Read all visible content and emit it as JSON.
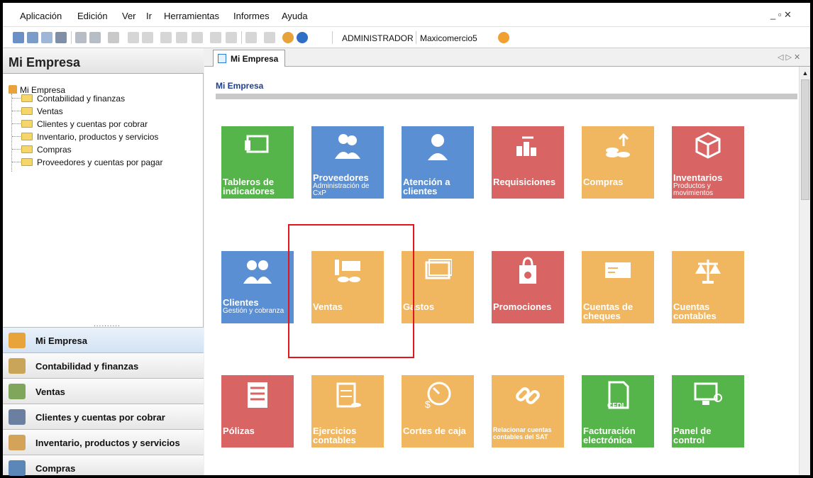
{
  "menubar": {
    "items": [
      "Aplicación",
      "Edición",
      "Ver",
      "Ir",
      "Herramientas",
      "Informes",
      "Ayuda"
    ],
    "window_controls": "_ ▫ ✕"
  },
  "toolbar": {
    "user": "ADMINISTRADOR",
    "company": "Maxicomercio5"
  },
  "left_panel": {
    "title": "Mi Empresa",
    "tree_root": "Mi Empresa",
    "tree_children": [
      "Contabilidad y finanzas",
      "Ventas",
      "Clientes y cuentas por cobrar",
      "Inventario, productos y servicios",
      "Compras",
      "Proveedores y cuentas por pagar"
    ],
    "dots": "..........",
    "nav": [
      "Mi Empresa",
      "Contabilidad y finanzas",
      "Ventas",
      "Clientes y cuentas por cobrar",
      "Inventario, productos y servicios",
      "Compras"
    ]
  },
  "tab": {
    "label": "Mi Empresa",
    "nav_controls": "◁ ▷ ✕"
  },
  "content": {
    "section_title": "Mi Empresa",
    "tiles": [
      {
        "title": "Tableros de indicadores",
        "subtitle": "",
        "color": "#55b44a",
        "icon": "dashboard-icon"
      },
      {
        "title": "Proveedores",
        "subtitle": "Administración de CxP",
        "color": "#5b8fd4",
        "icon": "suppliers-icon"
      },
      {
        "title": "Atención a clientes",
        "subtitle": "",
        "color": "#5b8fd4",
        "icon": "customer-service-icon"
      },
      {
        "title": "Requisiciones",
        "subtitle": "",
        "color": "#d86463",
        "icon": "requisitions-icon"
      },
      {
        "title": "Compras",
        "subtitle": "",
        "color": "#f0b760",
        "icon": "purchases-icon"
      },
      {
        "title": "Inventarios",
        "subtitle": "Productos y movimientos",
        "color": "#d86463",
        "icon": "inventory-icon"
      },
      {
        "title": "Clientes",
        "subtitle": "Gestión y cobranza",
        "color": "#5b8fd4",
        "icon": "clients-icon"
      },
      {
        "title": "Ventas",
        "subtitle": "",
        "color": "#f0b760",
        "icon": "sales-icon"
      },
      {
        "title": "Gastos",
        "subtitle": "",
        "color": "#f0b760",
        "icon": "expenses-icon"
      },
      {
        "title": "Promociones",
        "subtitle": "",
        "color": "#d86463",
        "icon": "promotions-icon"
      },
      {
        "title": "Cuentas de cheques",
        "subtitle": "",
        "color": "#f0b760",
        "icon": "checks-icon"
      },
      {
        "title": "Cuentas contables",
        "subtitle": "",
        "color": "#f0b760",
        "icon": "accounts-icon"
      },
      {
        "title": "Pólizas",
        "subtitle": "",
        "color": "#d86463",
        "icon": "policies-icon"
      },
      {
        "title": "Ejercicios contables",
        "subtitle": "",
        "color": "#f0b760",
        "icon": "fiscal-years-icon"
      },
      {
        "title": "Cortes de caja",
        "subtitle": "",
        "color": "#f0b760",
        "icon": "cash-cut-icon"
      },
      {
        "title": "Relacionar cuentas contables del SAT",
        "subtitle": "",
        "color": "#f0b760",
        "icon": "link-icon"
      },
      {
        "title": "Facturación electrónica",
        "subtitle": "",
        "color": "#55b44a",
        "icon": "cfdi-icon",
        "badge": "CFDI"
      },
      {
        "title": "Panel de control",
        "subtitle": "",
        "color": "#55b44a",
        "icon": "control-panel-icon"
      }
    ]
  }
}
